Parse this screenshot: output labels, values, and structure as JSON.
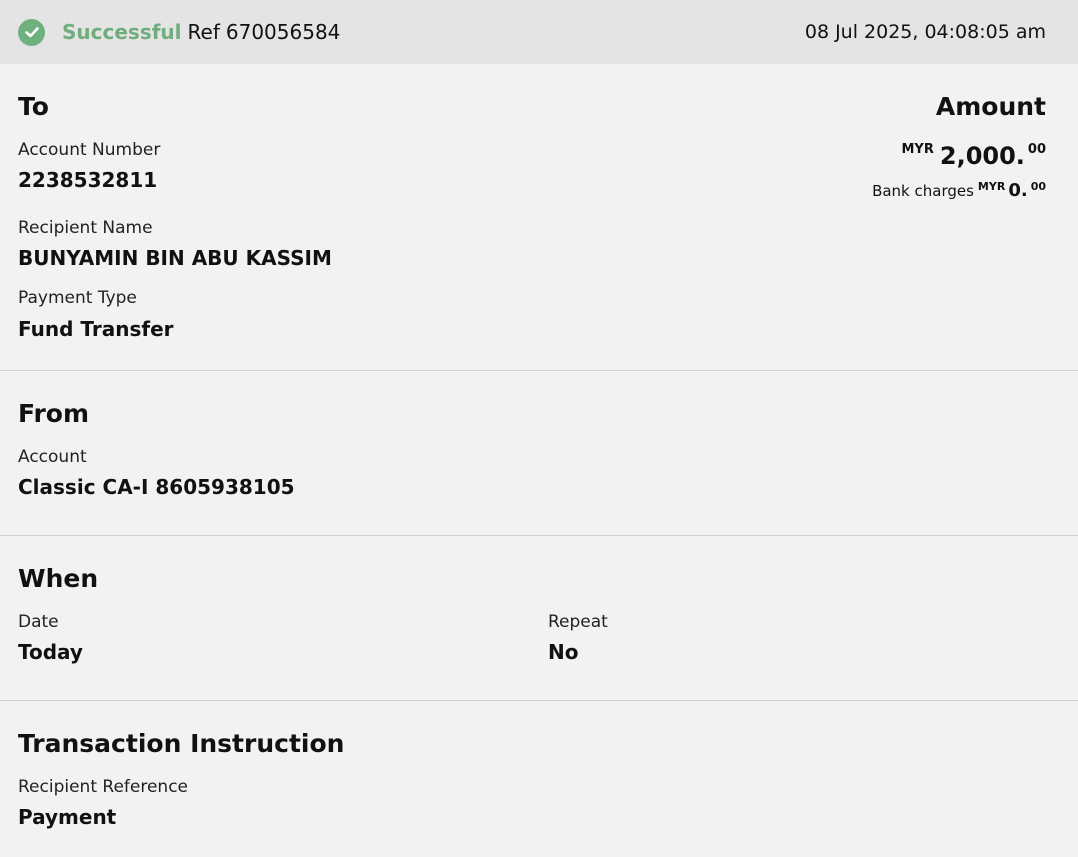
{
  "status": {
    "text": "Successful",
    "ref_label": "Ref",
    "ref_number": "670056584",
    "datetime": "08 Jul 2025, 04:08:05 am"
  },
  "to": {
    "title": "To",
    "account_number_label": "Account Number",
    "account_number": "2238532811",
    "recipient_name_label": "Recipient Name",
    "recipient_name": "BUNYAMIN BIN ABU KASSIM",
    "payment_type_label": "Payment Type",
    "payment_type": "Fund Transfer"
  },
  "amount": {
    "title": "Amount",
    "currency": "MYR",
    "whole": "2,000.",
    "cents": "00",
    "bank_charges_label": "Bank charges",
    "charges_currency": "MYR",
    "charges_whole": "0.",
    "charges_cents": "00"
  },
  "from": {
    "title": "From",
    "account_label": "Account",
    "account": "Classic CA-I 8605938105"
  },
  "when": {
    "title": "When",
    "date_label": "Date",
    "date": "Today",
    "repeat_label": "Repeat",
    "repeat": "No"
  },
  "instruction": {
    "title": "Transaction Instruction",
    "reference_label": "Recipient Reference",
    "reference": "Payment"
  },
  "colors": {
    "success": "#6fae7c",
    "header_bg": "#e4e4e4",
    "page_bg": "#f2f2f2"
  }
}
